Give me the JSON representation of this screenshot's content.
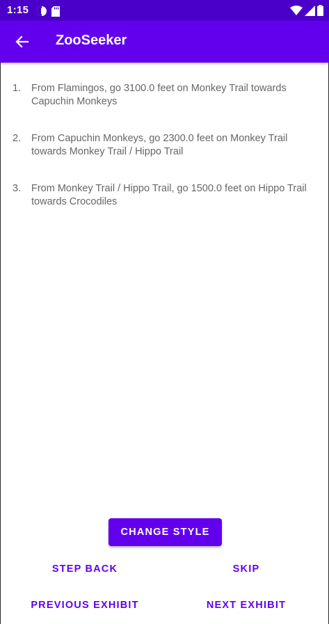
{
  "status_bar": {
    "time": "1:15",
    "left_icons": [
      "data-saver-icon",
      "sd-card-icon"
    ],
    "right_icons": [
      "wifi-icon",
      "cell-signal-icon",
      "battery-icon"
    ],
    "background": "#4a00c8"
  },
  "app_bar": {
    "title": "ZooSeeker",
    "back_icon": "arrow-back-icon",
    "background": "#6200ee"
  },
  "steps": [
    {
      "number": "1.",
      "text": "From Flamingos, go 3100.0 feet on Monkey Trail towards Capuchin Monkeys"
    },
    {
      "number": "2.",
      "text": "From Capuchin Monkeys, go 2300.0 feet on Monkey Trail towards Monkey Trail / Hippo Trail"
    },
    {
      "number": "3.",
      "text": "From Monkey Trail / Hippo Trail, go 1500.0 feet on Hippo Trail towards Crocodiles"
    }
  ],
  "buttons": {
    "change_style": "CHANGE STYLE",
    "step_back": "STEP BACK",
    "skip": "SKIP",
    "previous_exhibit": "PREVIOUS EXHIBIT",
    "next_exhibit": "NEXT EXHIBIT"
  },
  "colors": {
    "accent": "#6200ee",
    "step_text": "#666666"
  }
}
